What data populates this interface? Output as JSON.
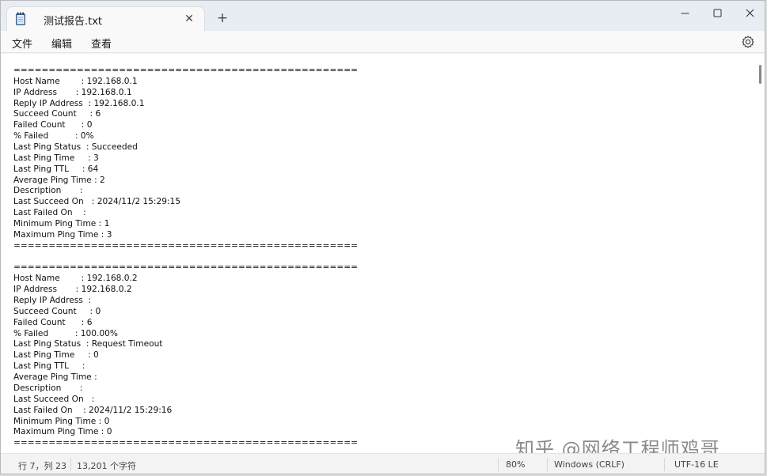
{
  "tab": {
    "title": "测试报告.txt",
    "close_glyph": "✕"
  },
  "new_tab_glyph": "+",
  "window_controls": {
    "minimize": "—",
    "maximize": "☐",
    "close": "✕"
  },
  "menu": {
    "file": "文件",
    "edit": "编辑",
    "view": "查看"
  },
  "content": {
    "lines": [
      "=================================================",
      "Host Name        : 192.168.0.1",
      "IP Address       : 192.168.0.1",
      "Reply IP Address  : 192.168.0.1",
      "Succeed Count     : 6",
      "Failed Count      : 0",
      "% Failed          : 0%",
      "Last Ping Status  : Succeeded",
      "Last Ping Time     : 3",
      "Last Ping TTL     : 64",
      "Average Ping Time : 2",
      "Description       :",
      "Last Succeed On   : 2024/11/2 15:29:15",
      "Last Failed On    :",
      "Minimum Ping Time : 1",
      "Maximum Ping Time : 3",
      "=================================================",
      "",
      "=================================================",
      "Host Name        : 192.168.0.2",
      "IP Address       : 192.168.0.2",
      "Reply IP Address  :",
      "Succeed Count     : 0",
      "Failed Count      : 6",
      "% Failed          : 100.00%",
      "Last Ping Status  : Request Timeout",
      "Last Ping Time     : 0",
      "Last Ping TTL     :",
      "Average Ping Time :",
      "Description       :",
      "Last Succeed On   :",
      "Last Failed On    : 2024/11/2 15:29:16",
      "Minimum Ping Time : 0",
      "Maximum Ping Time : 0",
      "================================================="
    ]
  },
  "watermark": "知乎 @网络工程师鸡哥",
  "status": {
    "position": "行 7，列 23",
    "char_count": "13,201 个字符",
    "zoom": "80%",
    "line_ending": "Windows (CRLF)",
    "encoding": "UTF-16 LE"
  },
  "icons": {
    "app": "notepad-icon",
    "settings": "gear-icon"
  }
}
